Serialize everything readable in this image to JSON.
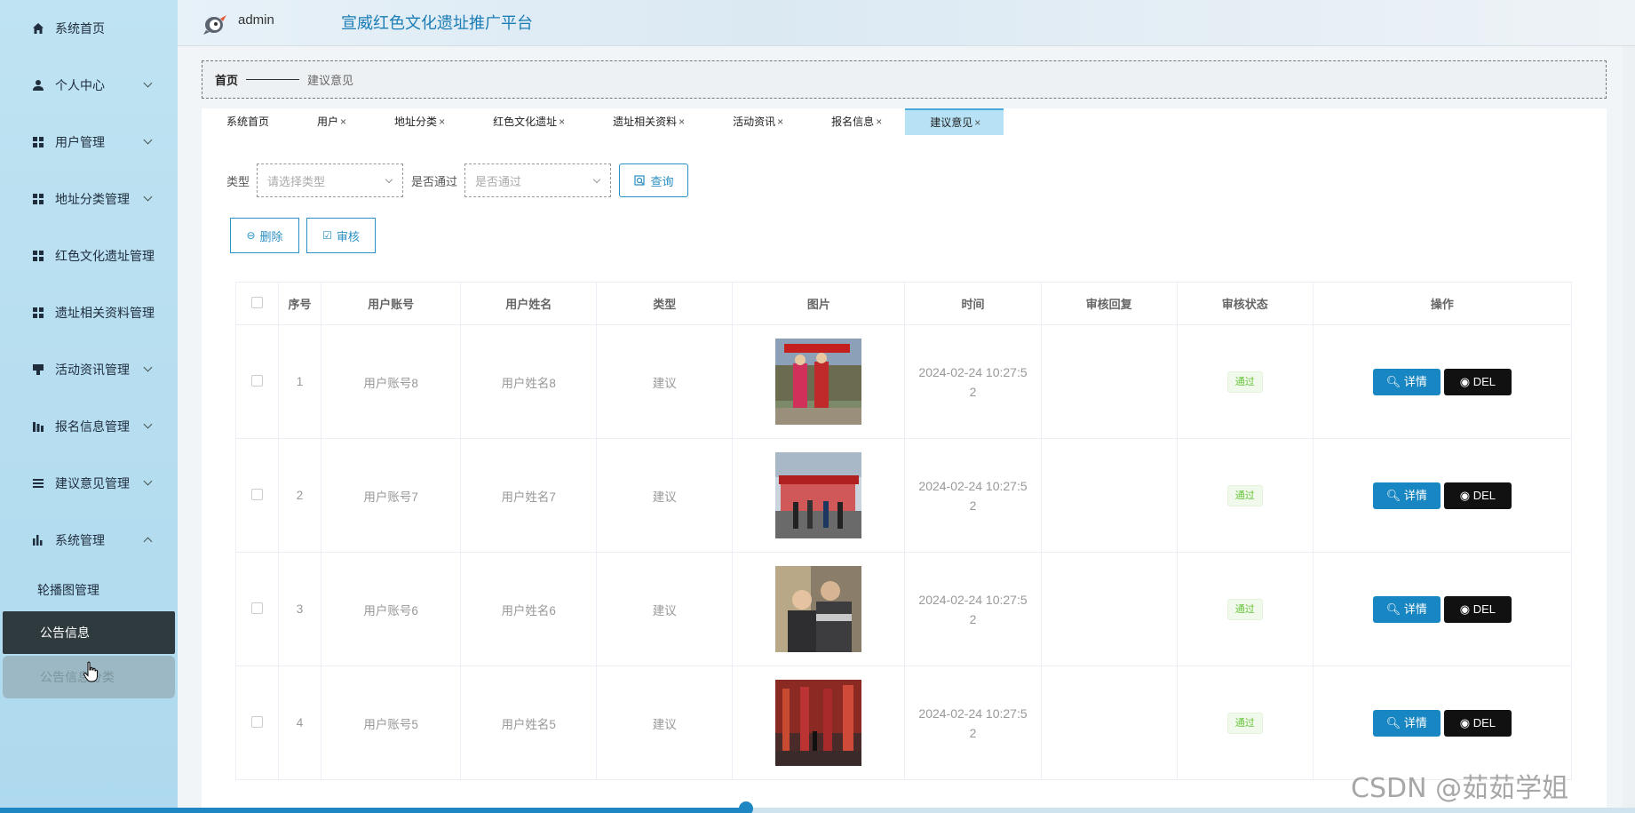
{
  "sidebar": {
    "items": [
      {
        "label": "系统首页",
        "icon": "home-icon"
      },
      {
        "label": "个人中心",
        "icon": "user-icon"
      },
      {
        "label": "用户管理",
        "icon": "grid-icon"
      },
      {
        "label": "地址分类管理",
        "icon": "grid-icon"
      },
      {
        "label": "红色文化遗址管理",
        "icon": "grid-icon"
      },
      {
        "label": "遗址相关资料管理",
        "icon": "grid-icon"
      },
      {
        "label": "活动资讯管理",
        "icon": "news-icon"
      },
      {
        "label": "报名信息管理",
        "icon": "bar-icon"
      },
      {
        "label": "建议意见管理",
        "icon": "list-icon"
      },
      {
        "label": "系统管理",
        "icon": "chart-icon"
      }
    ],
    "sub_items": [
      {
        "label": "轮播图管理"
      },
      {
        "label": "公告信息"
      },
      {
        "label": "公告信息分类"
      }
    ]
  },
  "header": {
    "username": "admin",
    "title": "宣威红色文化遗址推广平台"
  },
  "breadcrumb": {
    "home": "首页",
    "current": "建议意见"
  },
  "tabs": [
    {
      "label": "系统首页",
      "closable": false
    },
    {
      "label": "用户",
      "closable": true
    },
    {
      "label": "地址分类",
      "closable": true
    },
    {
      "label": "红色文化遗址",
      "closable": true
    },
    {
      "label": "遗址相关资料",
      "closable": true
    },
    {
      "label": "活动资讯",
      "closable": true
    },
    {
      "label": "报名信息",
      "closable": true
    },
    {
      "label": "建议意见",
      "closable": true,
      "active": true
    }
  ],
  "tab_close_glyph": "×",
  "filter": {
    "type_label": "类型",
    "type_placeholder": "请选择类型",
    "pass_label": "是否通过",
    "pass_placeholder": "是否通过",
    "query_label": "查询"
  },
  "actions": {
    "delete_label": "删除",
    "audit_label": "审核"
  },
  "table": {
    "columns": [
      "序号",
      "用户账号",
      "用户姓名",
      "类型",
      "图片",
      "时间",
      "审核回复",
      "审核状态",
      "操作"
    ],
    "rows": [
      {
        "index": "1",
        "account": "用户账号8",
        "name": "用户姓名8",
        "type": "建议",
        "time_a": "2024-02-24 10:27:5",
        "time_b": "2",
        "reply": "",
        "status": "通过"
      },
      {
        "index": "2",
        "account": "用户账号7",
        "name": "用户姓名7",
        "type": "建议",
        "time_a": "2024-02-24 10:27:5",
        "time_b": "2",
        "reply": "",
        "status": "通过"
      },
      {
        "index": "3",
        "account": "用户账号6",
        "name": "用户姓名6",
        "type": "建议",
        "time_a": "2024-02-24 10:27:5",
        "time_b": "2",
        "reply": "",
        "status": "通过"
      },
      {
        "index": "4",
        "account": "用户账号5",
        "name": "用户姓名5",
        "type": "建议",
        "time_a": "2024-02-24 10:27:5",
        "time_b": "2",
        "reply": "",
        "status": "通过"
      }
    ],
    "detail_label": "详情",
    "del_label": "DEL"
  },
  "colors": {
    "accent": "#1886c2",
    "sidebar_bg": "#aed9ee",
    "status_pass": "#67c23a",
    "del_bg": "#111111"
  },
  "watermark": "CSDN @茹茹学姐"
}
